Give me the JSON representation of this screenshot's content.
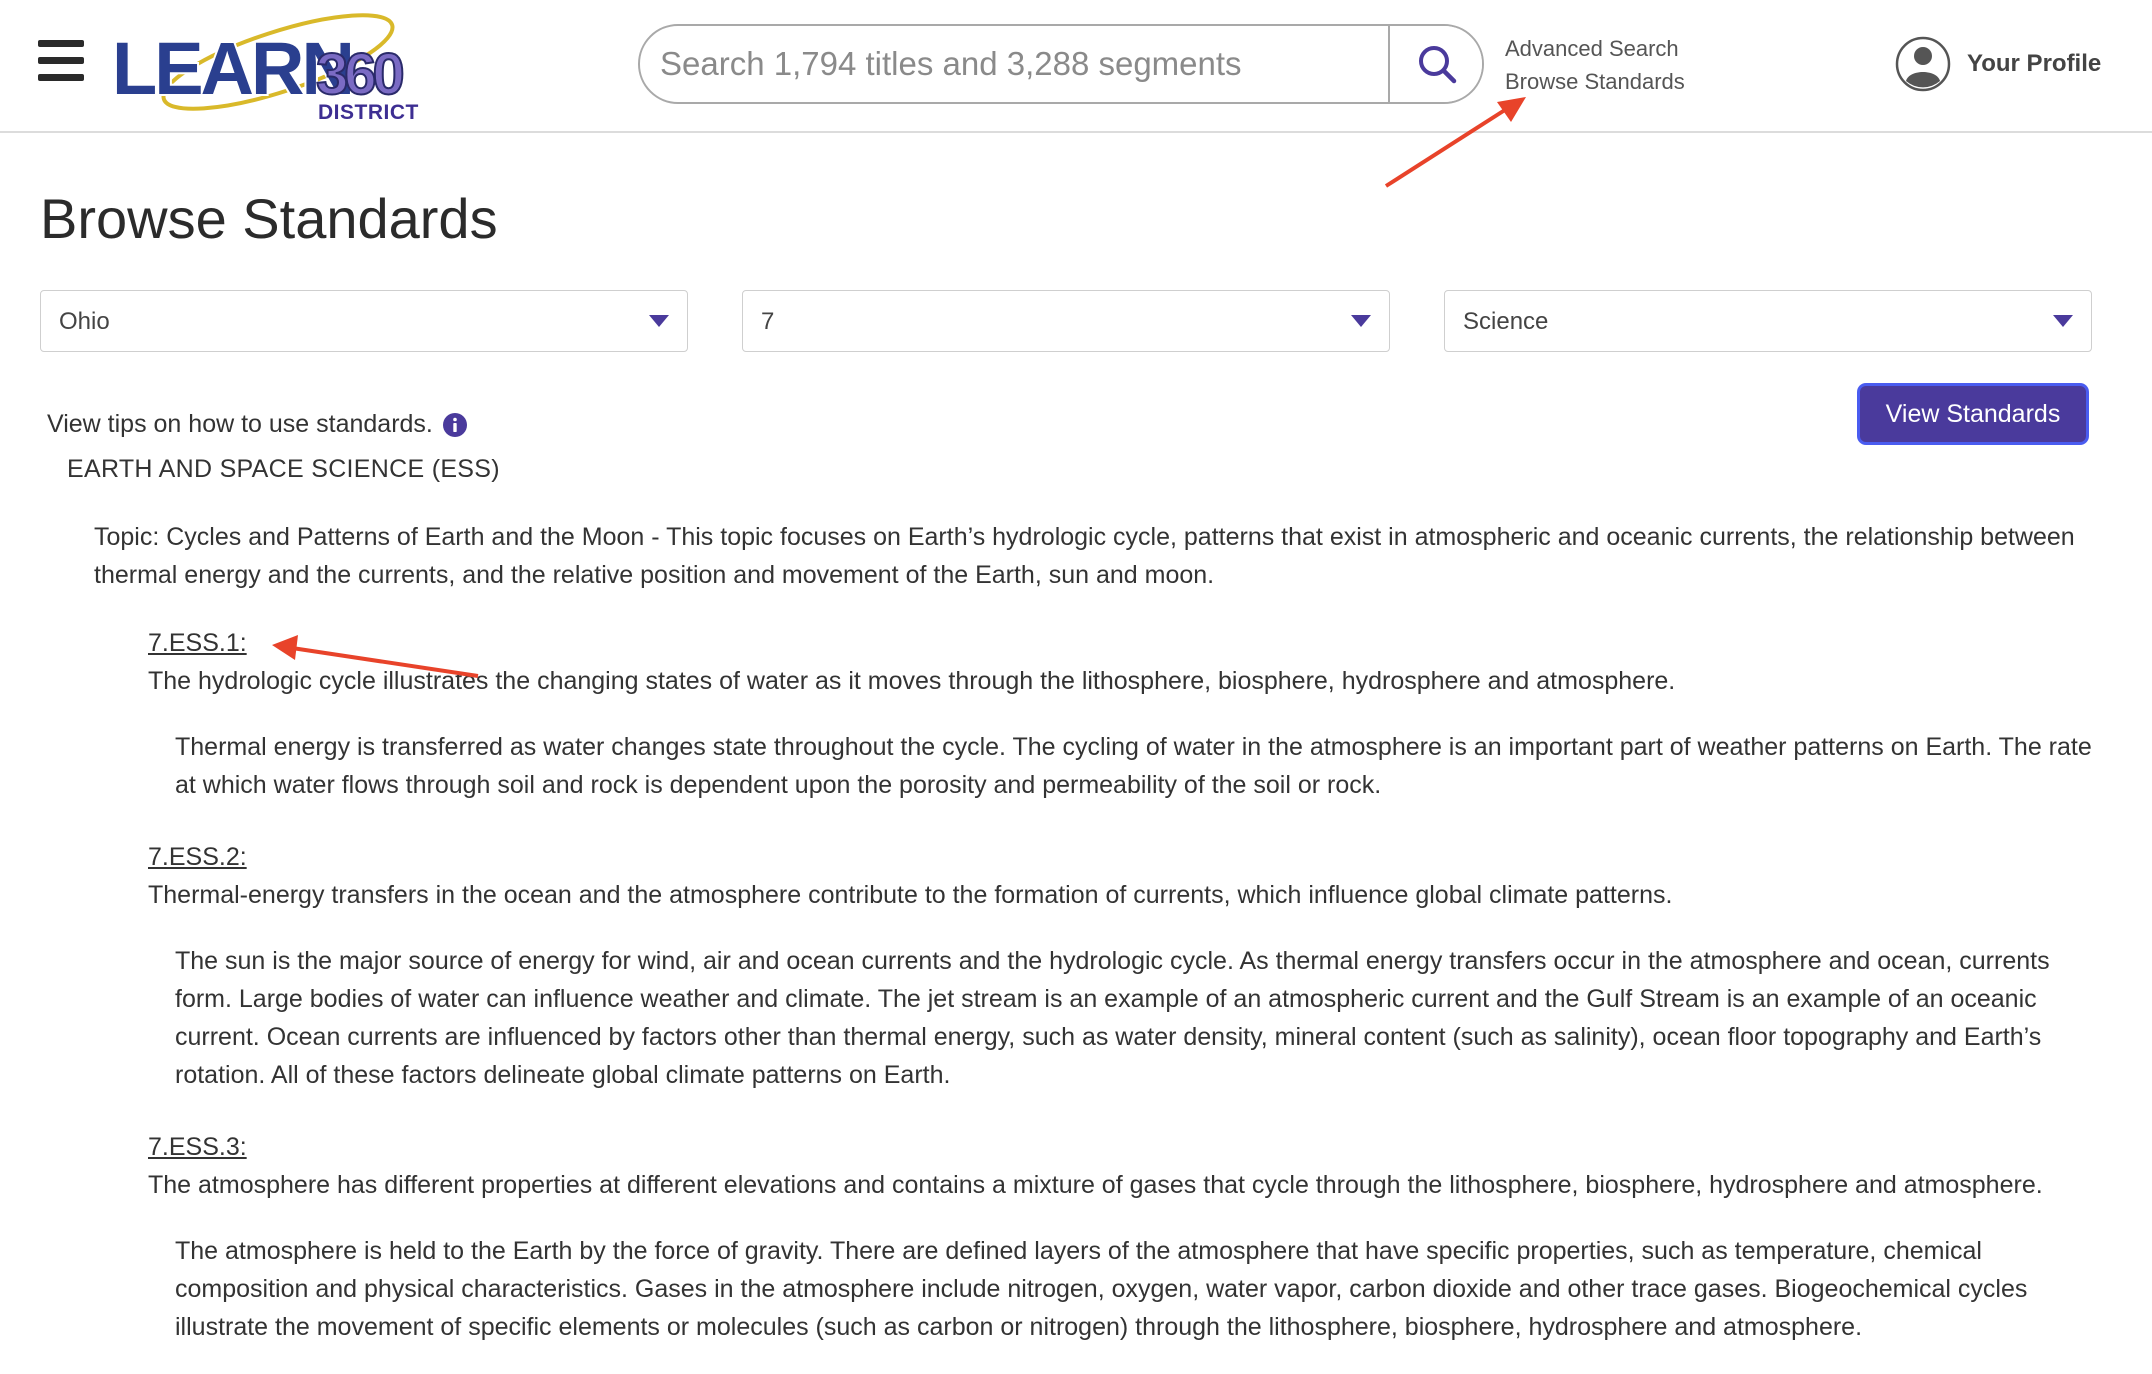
{
  "header": {
    "logo_text": "LEARN360",
    "logo_sub": "DISTRICT",
    "search_placeholder": "Search 1,794 titles and 3,288 segments",
    "links": [
      "Advanced Search",
      "Browse Standards"
    ],
    "profile_label": "Your Profile"
  },
  "page": {
    "title": "Browse Standards"
  },
  "filters": {
    "state": "Ohio",
    "grade": "7",
    "subject": "Science"
  },
  "view_button": "View Standards",
  "tips_text": "View tips on how to use standards.",
  "section_heading": "EARTH AND SPACE SCIENCE (ESS)",
  "topic": "Topic: Cycles and Patterns of Earth and the Moon - This topic focuses on Earth’s hydrologic cycle, patterns that exist in atmospheric and oceanic currents, the relationship between thermal energy and the currents, and the relative position and movement of the Earth, sun and moon.",
  "standards": [
    {
      "code": "7.ESS.1:",
      "desc": "The hydrologic cycle illustrates the changing states of water as it moves through the lithosphere, biosphere, hydrosphere and atmosphere.",
      "detail": "Thermal energy is transferred as water changes state throughout the cycle. The cycling of water in the atmosphere is an important part of weather patterns on Earth. The rate at which water flows through soil and rock is dependent upon the porosity and permeability of the soil or rock."
    },
    {
      "code": "7.ESS.2:",
      "desc": "Thermal-energy transfers in the ocean and the atmosphere contribute to the formation of currents, which influence global climate patterns.",
      "detail": "The sun is the major source of energy for wind, air and ocean currents and the hydrologic cycle. As thermal energy transfers occur in the atmosphere and ocean, currents form. Large bodies of water can influence weather and climate. The jet stream is an example of an atmospheric current and the Gulf Stream is an example of an oceanic current. Ocean currents are influenced by factors other than thermal energy, such as water density, mineral content (such as salinity), ocean floor topography and Earth’s rotation. All of these factors delineate global climate patterns on Earth."
    },
    {
      "code": "7.ESS.3:",
      "desc": "The atmosphere has different properties at different elevations and contains a mixture of gases that cycle through the lithosphere, biosphere, hydrosphere and atmosphere.",
      "detail": "The atmosphere is held to the Earth by the force of gravity. There are defined layers of the atmosphere that have specific properties, such as temperature, chemical composition and physical characteristics. Gases in the atmosphere include nitrogen, oxygen, water vapor, carbon dioxide and other trace gases. Biogeochemical cycles illustrate the movement of specific elements or molecules (such as carbon or nitrogen) through the lithosphere, biosphere, hydrosphere and atmosphere."
    }
  ],
  "colors": {
    "brand": "#4a3a9c",
    "annotation_arrow": "#e8432a"
  }
}
